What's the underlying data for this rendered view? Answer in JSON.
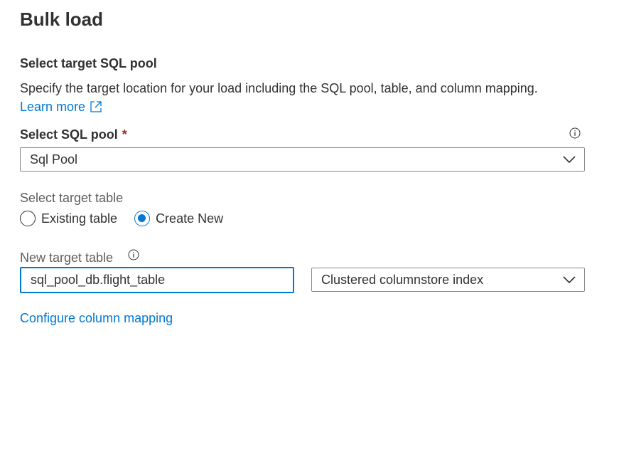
{
  "panel": {
    "title": "Bulk load",
    "section_heading": "Select target SQL pool",
    "description": "Specify the target location for your load including the SQL pool, table, and column mapping.",
    "learn_more": "Learn more"
  },
  "sql_pool": {
    "label": "Select SQL pool",
    "required_mark": "*",
    "value": "Sql Pool",
    "icons": [
      "info-icon",
      "chevron-down-icon"
    ]
  },
  "target_table": {
    "label": "Select target table",
    "options": [
      {
        "label": "Existing table",
        "checked": false
      },
      {
        "label": "Create New",
        "checked": true
      }
    ]
  },
  "new_table": {
    "label": "New target table",
    "value": "sql_pool_db.flight_table",
    "index_type": "Clustered columnstore index"
  },
  "configure_link": "Configure column mapping",
  "colors": {
    "accent": "#0078d4",
    "required": "#a4262c",
    "text": "#323130"
  }
}
